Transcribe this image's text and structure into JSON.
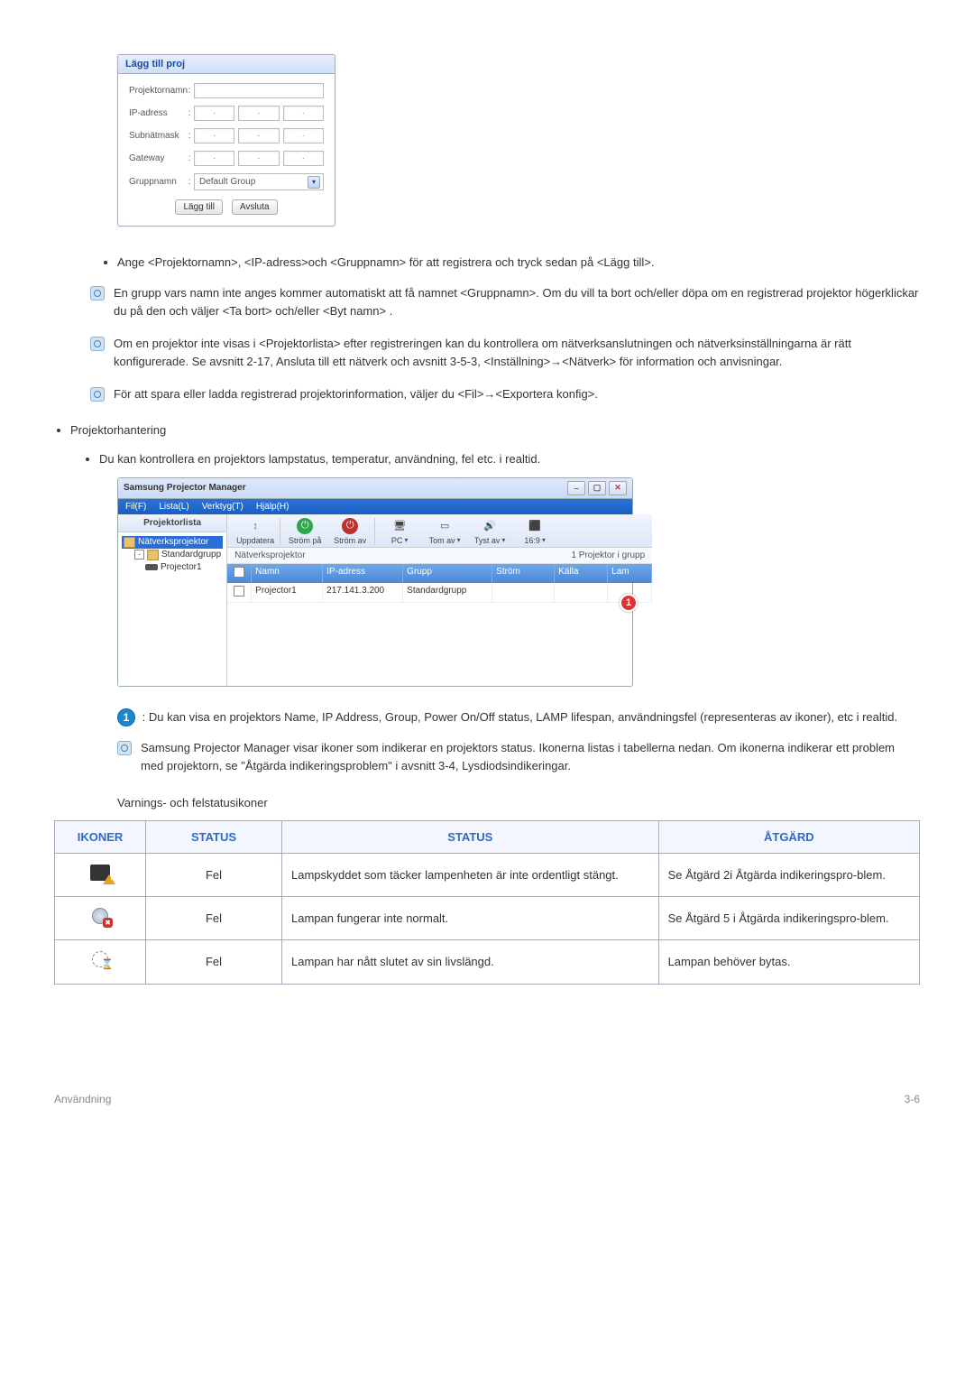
{
  "dialog": {
    "title": "Lägg till proj",
    "fields": {
      "projector_name": "Projektornamn",
      "ip_address": "IP-adress",
      "subnet_mask": "Subnätmask",
      "gateway": "Gateway",
      "group_name": "Gruppnamn"
    },
    "group_value": "Default Group",
    "btn_add": "Lägg till",
    "btn_cancel": "Avsluta"
  },
  "bullets": {
    "register": "Ange <Projektornamn>, <IP-adress>och <Gruppnamn> för att registrera och tryck sedan på <Lägg till>.",
    "note1": "En grupp vars namn inte anges kommer automatiskt att få namnet <Gruppnamn>. Om du vill ta bort och/eller döpa om en registrerad projektor högerklickar du på den och väljer <Ta bort> och/eller <Byt namn> .",
    "note2": "Om en projektor inte visas i <Projektorlista> efter registreringen kan du kontrollera om nätverksanslutningen och nätverksinställningarna är rätt konfigurerade. Se avsnitt 2-17, Ansluta till ett nätverk och avsnitt 3-5-3, <Inställning>→<Nätverk> för information och anvisningar.",
    "note3": "För att spara eller ladda registrerad projektorinformation, väljer du <Fil>→<Exportera konfig>.",
    "pm_heading": "Projektorhantering",
    "pm_sub": "Du kan kontrollera en projektors lampstatus, temperatur, användning, fel etc. i realtid."
  },
  "app": {
    "title": "Samsung Projector Manager",
    "menu": {
      "file": "Fil(F)",
      "list": "Lista(L)",
      "tools": "Verktyg(T)",
      "help": "Hjälp(H)"
    },
    "sidebar_header": "Projektorlista",
    "tree": {
      "root": "Nätverksprojektor",
      "group": "Standardgrupp",
      "item": "Projector1"
    },
    "toolbar": {
      "refresh": "Uppdatera",
      "power_on": "Ström på",
      "power_off": "Ström av",
      "source": "PC",
      "blank": "Tom av",
      "mute": "Tyst av",
      "aspect": "16:9"
    },
    "status": {
      "left": "Nätverksprojektor",
      "right": "1 Projektor i grupp"
    },
    "grid": {
      "headers": {
        "name": "Namn",
        "ip": "IP-adress",
        "group": "Grupp",
        "power": "Ström",
        "source": "Källa",
        "lamp": "Lam"
      },
      "row": {
        "name": "Projector1",
        "ip": "217.141.3.200",
        "group": "Standardgrupp",
        "power": "",
        "source": "",
        "lamp": ""
      }
    },
    "callout": "1"
  },
  "after_app": {
    "badge": "1",
    "text": " : Du kan visa en projektors Name, IP Address, Group, Power On/Off status, LAMP lifespan, användningsfel (representeras av ikoner), etc i realtid.",
    "note": "Samsung Projector Manager visar ikoner som indikerar en projektors status. Ikonerna listas i tabellerna nedan. Om ikonerna indikerar ett problem med projektorn, se \"Åtgärda indikeringsproblem\" i avsnitt 3-4, Lysdiodsindikeringar.",
    "table_title": "Varnings- och felstatusikoner"
  },
  "table": {
    "headers": {
      "icon": "IKONER",
      "status1": "STATUS",
      "status2": "STATUS",
      "action": "ÅTGÄRD"
    },
    "rows": [
      {
        "status": "Fel",
        "desc": "Lampskyddet som täcker lampenheten är inte ordentligt stängt.",
        "action": "Se Åtgärd 2i Åtgärda indikeringspro-blem."
      },
      {
        "status": "Fel",
        "desc": "Lampan fungerar inte normalt.",
        "action": "Se Åtgärd 5 i Åtgärda indikeringspro-blem."
      },
      {
        "status": "Fel",
        "desc": "Lampan har nått slutet av sin livslängd.",
        "action": "Lampan behöver bytas."
      }
    ]
  },
  "footer": {
    "left": "Användning",
    "right": "3-6"
  }
}
